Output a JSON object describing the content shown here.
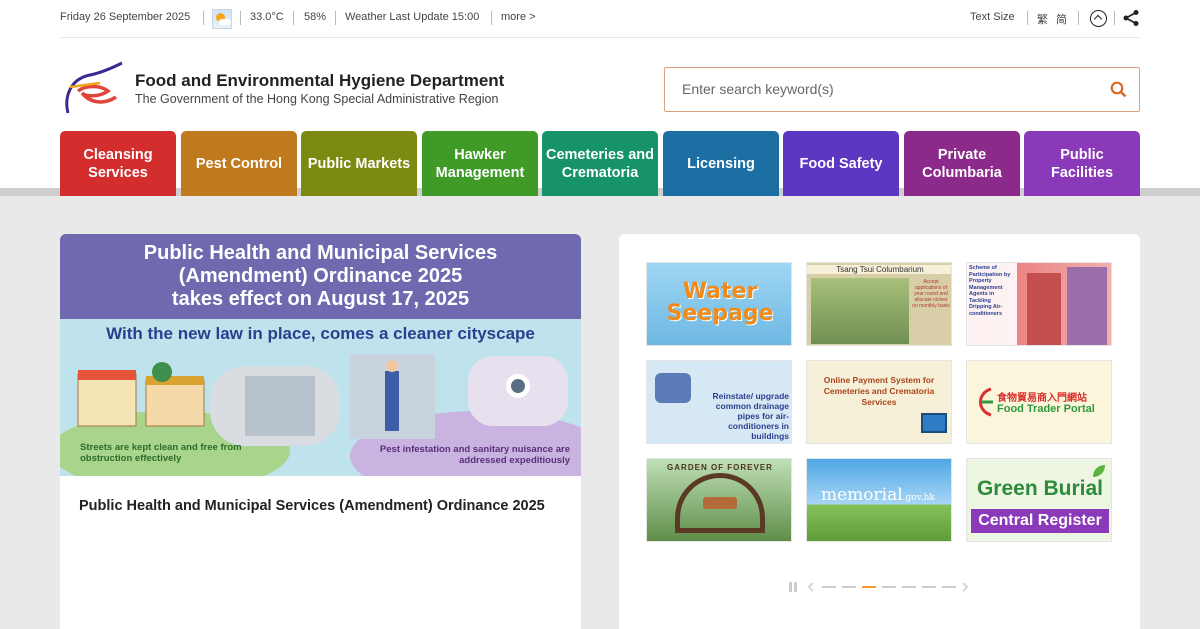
{
  "topbar": {
    "date": "Friday 26 September 2025",
    "temperature": "33.0°C",
    "humidity": "58%",
    "weather_update": "Weather Last Update 15:00",
    "more": "more >",
    "text_size": "Text Size",
    "lang_trad": "繁",
    "lang_simp": "简"
  },
  "header": {
    "dept_name": "Food and Environmental Hygiene Department",
    "dept_sub": "The Government of the Hong Kong Special Administrative Region"
  },
  "search": {
    "placeholder": "Enter search keyword(s)"
  },
  "nav": [
    {
      "label": "Cleansing Services",
      "color": "#d32d2d"
    },
    {
      "label": "Pest Control",
      "color": "#c07a1e"
    },
    {
      "label": "Public Markets",
      "color": "#7c8a12"
    },
    {
      "label": "Hawker Management",
      "color": "#3f9a28"
    },
    {
      "label": "Cemeteries and Crematoria",
      "color": "#16936a"
    },
    {
      "label": "Licensing",
      "color": "#1c6fa3"
    },
    {
      "label": "Food Safety",
      "color": "#5b37c2"
    },
    {
      "label": "Private Columbaria",
      "color": "#8c2a8c"
    },
    {
      "label": "Public Facilities",
      "color": "#8a3ab9"
    }
  ],
  "banner": {
    "headline1": "Public Health and Municipal Services",
    "headline2": "(Amendment) Ordinance 2025",
    "headline3": "takes effect on August 17, 2025",
    "tagline": "With the new law in place, comes a cleaner cityscape",
    "caption_left": "Streets are kept clean and free from obstruction effectively",
    "caption_right": "Pest infestation and sanitary nuisance are addressed expeditiously"
  },
  "news": {
    "title": "Public Health and Municipal Services (Amendment) Ordinance 2025"
  },
  "tiles": {
    "water_seepage": "Water Seepage",
    "tsang_tsui": "Tsang Tsui Columbarium",
    "tsang_tsui_note": "Accept applications of year round and allocate niches on monthly basis",
    "participation": "Scheme of Participation by Property Management Agents in Tackling Dripping Air-conditioners",
    "reinstate": "Reinstate/ upgrade common drainage pipes for air-conditioners in buildings",
    "online_payment": "Online Payment System for Cemeteries and Crematoria Services",
    "food_trader_cn": "食物貿易商入門網站",
    "food_trader_en": "Food Trader Portal",
    "remembrance": "GARDEN OF FOREVER",
    "memorial": "memorial",
    "memorial_domain": ".gov.hk",
    "green_burial": "Green Burial",
    "central_register": "Central Register"
  },
  "colors": {
    "accent": "#e07a2f",
    "nav_strip": "#cfcfcf",
    "banner_purple": "#6f69b0"
  }
}
